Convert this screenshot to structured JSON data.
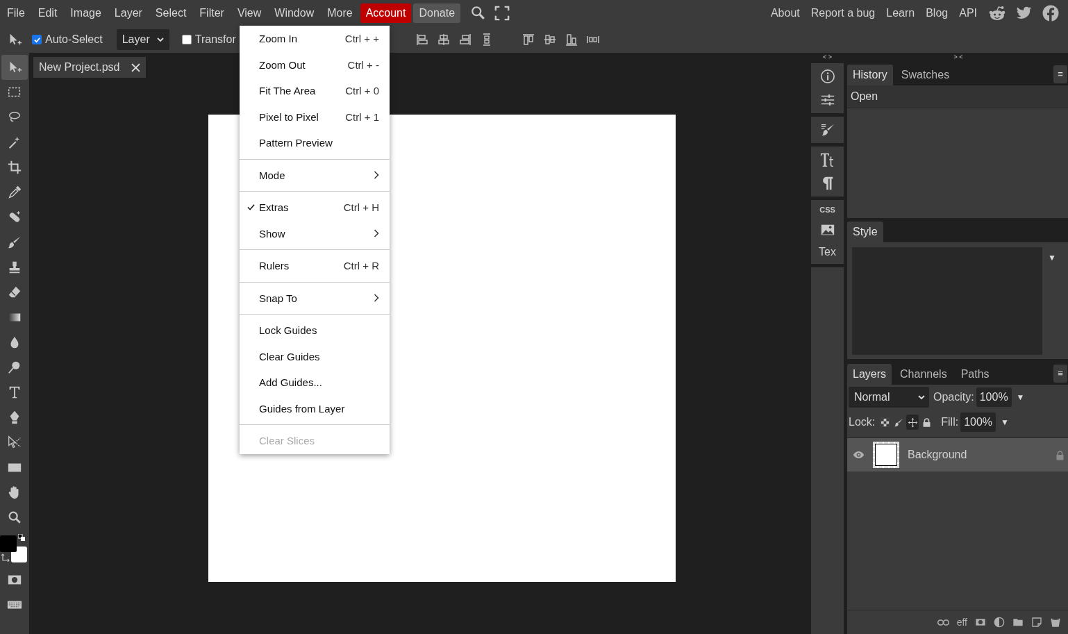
{
  "menubar": {
    "items": [
      {
        "label": "File",
        "kind": "menu"
      },
      {
        "label": "Edit",
        "kind": "menu"
      },
      {
        "label": "Image",
        "kind": "menu"
      },
      {
        "label": "Layer",
        "kind": "menu"
      },
      {
        "label": "Select",
        "kind": "menu"
      },
      {
        "label": "Filter",
        "kind": "menu"
      },
      {
        "label": "View",
        "kind": "menu"
      },
      {
        "label": "Window",
        "kind": "menu"
      },
      {
        "label": "More",
        "kind": "menu"
      },
      {
        "label": "Account",
        "kind": "account"
      },
      {
        "label": "Donate",
        "kind": "donate"
      }
    ],
    "links": [
      "About",
      "Report a bug",
      "Learn",
      "Blog",
      "API"
    ]
  },
  "options_bar": {
    "auto_select": {
      "label": "Auto-Select",
      "checked": true
    },
    "target": "Layer",
    "transform": {
      "label": "Transfor",
      "checked": false
    }
  },
  "document_tab": {
    "title": "New Project.psd"
  },
  "tools": [
    {
      "selected": true
    },
    {
      "selected": false
    },
    {
      "selected": false
    },
    {
      "selected": false
    },
    {
      "selected": false
    },
    {
      "selected": false
    },
    {
      "selected": false
    },
    {
      "selected": false
    },
    {
      "selected": false
    },
    {
      "selected": false
    },
    {
      "selected": false
    },
    {
      "selected": false
    },
    {
      "selected": false
    },
    {
      "selected": false
    },
    {
      "selected": false
    },
    {
      "selected": false
    },
    {
      "selected": false
    },
    {
      "selected": false
    },
    {
      "selected": false
    }
  ],
  "view_menu": [
    {
      "kind": "item",
      "label": "Zoom In",
      "shortcut": "Ctrl + +",
      "checked": false,
      "disabled": false
    },
    {
      "kind": "item",
      "label": "Zoom Out",
      "shortcut": "Ctrl + -",
      "checked": false,
      "disabled": false
    },
    {
      "kind": "item",
      "label": "Fit The Area",
      "shortcut": "Ctrl + 0",
      "checked": false,
      "disabled": false
    },
    {
      "kind": "item",
      "label": "Pixel to Pixel",
      "shortcut": "Ctrl + 1",
      "checked": false,
      "disabled": false
    },
    {
      "kind": "item",
      "label": "Pattern Preview",
      "checked": false,
      "disabled": false
    },
    {
      "kind": "separator"
    },
    {
      "kind": "submenu",
      "label": "Mode",
      "checked": false,
      "disabled": false
    },
    {
      "kind": "separator"
    },
    {
      "kind": "item",
      "label": "Extras",
      "shortcut": "Ctrl + H",
      "checked": true,
      "disabled": false
    },
    {
      "kind": "submenu",
      "label": "Show",
      "checked": false,
      "disabled": false
    },
    {
      "kind": "separator"
    },
    {
      "kind": "item",
      "label": "Rulers",
      "shortcut": "Ctrl + R",
      "checked": false,
      "disabled": false
    },
    {
      "kind": "separator"
    },
    {
      "kind": "submenu",
      "label": "Snap To",
      "checked": false,
      "disabled": false
    },
    {
      "kind": "separator"
    },
    {
      "kind": "item",
      "label": "Lock Guides",
      "checked": false,
      "disabled": false
    },
    {
      "kind": "item",
      "label": "Clear Guides",
      "checked": false,
      "disabled": false
    },
    {
      "kind": "item",
      "label": "Add Guides...",
      "checked": false,
      "disabled": false
    },
    {
      "kind": "item",
      "label": "Guides from Layer",
      "checked": false,
      "disabled": false
    },
    {
      "kind": "separator"
    },
    {
      "kind": "item",
      "label": "Clear Slices",
      "checked": false,
      "disabled": true
    }
  ],
  "side_icons": {
    "collapse_left": "< >",
    "collapse_right": "> <",
    "css": "CSS",
    "text_label": "Tex"
  },
  "history_panel": {
    "tabs": [
      {
        "label": "History",
        "selected": true
      },
      {
        "label": "Swatches",
        "selected": false
      }
    ],
    "menu": "≡",
    "entries": [
      "Open"
    ]
  },
  "style_panel": {
    "tabs": [
      {
        "label": "Style",
        "selected": true
      }
    ],
    "dropdown": "▼"
  },
  "layers_panel": {
    "tabs": [
      {
        "label": "Layers",
        "selected": true
      },
      {
        "label": "Channels",
        "selected": false
      },
      {
        "label": "Paths",
        "selected": false
      }
    ],
    "menu": "≡",
    "blend_mode": "Normal",
    "opacity_label": "Opacity:",
    "opacity": "100%",
    "opacity_arrow": "▼",
    "lock_label": "Lock:",
    "locks": [
      {
        "on": false
      },
      {
        "on": false
      },
      {
        "on": true
      },
      {
        "on": false
      }
    ],
    "fill_label": "Fill:",
    "fill": "100%",
    "fill_arrow": "▼",
    "layers": [
      {
        "name": "Background",
        "selected": true,
        "visible": true,
        "locked": true
      }
    ],
    "effects_label": "eff"
  }
}
